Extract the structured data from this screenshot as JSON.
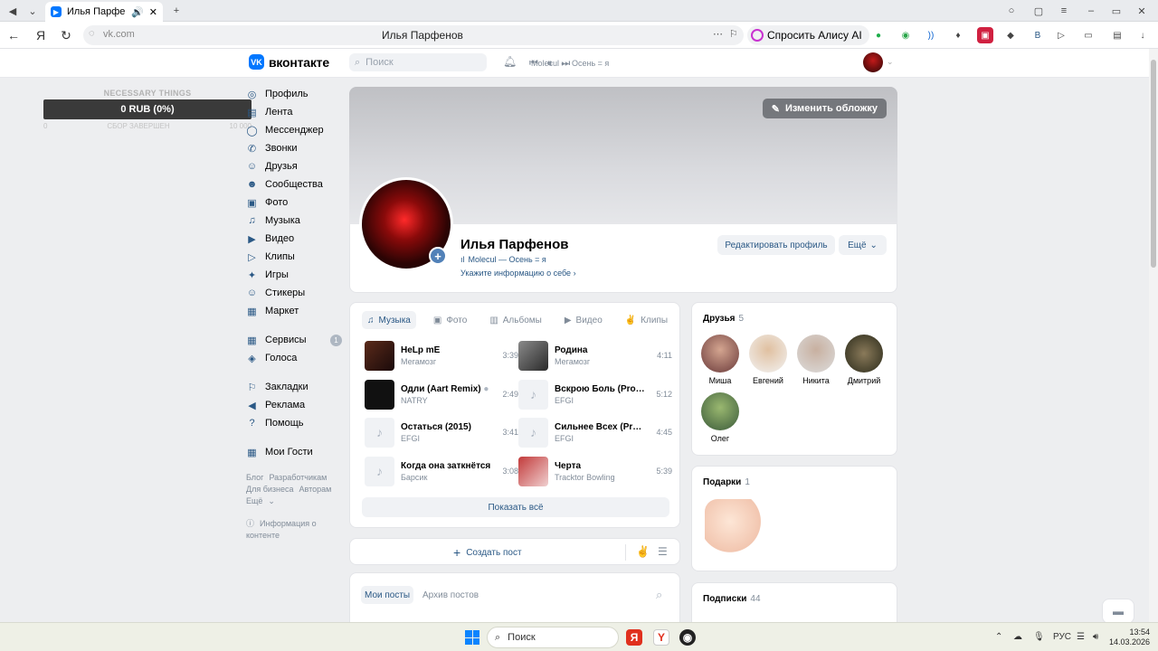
{
  "browser": {
    "tab_title": "Илья Парфенов",
    "url": "vk.com",
    "page_title": "Илья Парфенов",
    "alice_label": "Спросить Алису AI"
  },
  "header": {
    "logo_text": "вконтакте",
    "search_placeholder": "Поиск",
    "now_playing": "Molecul — Осень = я"
  },
  "donation": {
    "title": "NECESSARY THINGS",
    "amount": "0 RUB (0%)",
    "min": "0",
    "status": "СБОР ЗАВЕРШЕН",
    "max": "10 000"
  },
  "menu": {
    "items": [
      "Профиль",
      "Лента",
      "Мессенджер",
      "Звонки",
      "Друзья",
      "Сообщества",
      "Фото",
      "Музыка",
      "Видео",
      "Клипы",
      "Игры",
      "Стикеры",
      "Маркет"
    ],
    "items2": [
      "Сервисы",
      "Голоса"
    ],
    "services_count": "1",
    "items3": [
      "Закладки",
      "Реклама",
      "Помощь"
    ],
    "items4": [
      "Мои Гости"
    ],
    "footer": [
      "Блог",
      "Разработчикам",
      "Для бизнеса",
      "Авторам",
      "Ещё"
    ],
    "info": "Информация о контенте"
  },
  "profile": {
    "cover_button": "Изменить обложку",
    "name": "Илья Парфенов",
    "status": "Molecul — Осень = я",
    "info_link": "Укажите информацию о себе",
    "edit_button": "Редактировать профиль",
    "more_button": "Ещё"
  },
  "music": {
    "tabs": [
      "Музыка",
      "Фото",
      "Альбомы",
      "Видео",
      "Клипы"
    ],
    "tracks": [
      {
        "title": "HeLp mE",
        "artist": "Мегамозг",
        "duration": "3:39"
      },
      {
        "title": "Родина",
        "artist": "Мегамозг",
        "duration": "4:11"
      },
      {
        "title": "Одли (Aart Remix)",
        "artist": "NATRY",
        "duration": "2:49"
      },
      {
        "title": "Вскрою Боль (Prod...",
        "artist": "EFGI",
        "duration": "5:12"
      },
      {
        "title": "Остаться (2015)",
        "artist": "EFGI",
        "duration": "3:41"
      },
      {
        "title": "Сильнее Всех (Pro...",
        "artist": "EFGI",
        "duration": "4:45"
      },
      {
        "title": "Когда она заткнётся",
        "artist": "Барсик",
        "duration": "3:08"
      },
      {
        "title": "Черта",
        "artist": "Tracktor Bowling",
        "duration": "5:39"
      }
    ],
    "show_all": "Показать всё"
  },
  "create_post": "Создать пост",
  "posts": {
    "tab_mine": "Мои посты",
    "tab_archive": "Архив постов"
  },
  "friends": {
    "title": "Друзья",
    "count": "5",
    "names": [
      "Миша",
      "Евгений",
      "Никита",
      "Дмитрий",
      "Олег"
    ]
  },
  "gifts": {
    "title": "Подарки",
    "count": "1"
  },
  "subscriptions": {
    "title": "Подписки",
    "count": "44"
  },
  "taskbar": {
    "search": "Поиск",
    "lang": "РУС",
    "time": "13:54",
    "date": "14.03.2026"
  }
}
